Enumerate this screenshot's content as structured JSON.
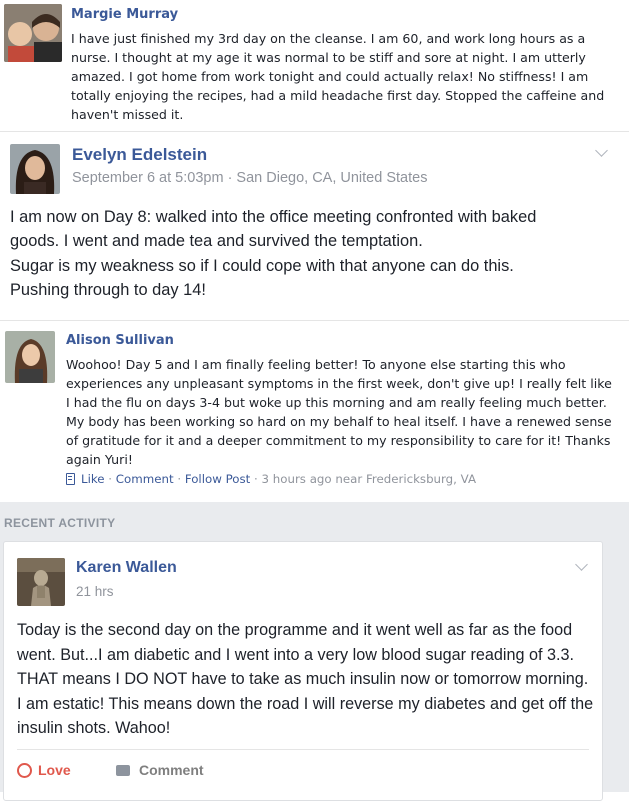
{
  "posts": [
    {
      "author": "Margie Murray",
      "text": "I have just finished my 3rd day on the cleanse. I am 60, and work long hours as a nurse. I thought at my age it was normal to be stiff and sore at night. I am utterly amazed. I got home from work tonight and could actually relax! No stiffness! I am totally enjoying the recipes, had a mild headache first day. Stopped the caffeine and haven't missed it."
    },
    {
      "author": "Evelyn Edelstein",
      "meta": "September 6 at 5:03pm · San Diego, CA, United States",
      "line1": "I am now on Day 8: walked into the office meeting confronted with baked",
      "line2": "goods. I went and made tea and survived the temptation.",
      "line3": "Sugar is my weakness so if I could cope with that anyone can do this.",
      "line4": "Pushing through to day 14!"
    },
    {
      "author": "Alison Sullivan",
      "text": "Woohoo! Day 5 and I am finally feeling better! To anyone else starting this who experiences any unpleasant symptoms in the first week, don't give up! I really felt like I had the flu on days 3-4 but woke up this morning and am really feeling much better. My body has been working so hard on my behalf to heal itself. I have a renewed sense of gratitude for it and a deeper commitment to my responsibility to care for it! Thanks again Yuri!",
      "actions": {
        "like": "Like",
        "sep1": " · ",
        "comment": "Comment",
        "sep2": " · ",
        "follow": "Follow Post",
        "time": " · 3 hours ago near Fredericksburg, VA"
      }
    }
  ],
  "recent_activity": {
    "header": "RECENT ACTIVITY",
    "post": {
      "author": "Karen Wallen",
      "meta": "21 hrs",
      "text": "Today is the second day on the programme and it went well as far as the food went. But...I am diabetic and I went into a very low blood sugar reading of 3.3. THAT means I DO NOT have to take as much insulin now or tomorrow morning. I am estatic! This means down the road I will reverse my diabetes and get off the insulin shots. Wahoo!",
      "love_label": "Love",
      "comment_label": "Comment"
    }
  },
  "colors": {
    "link": "#3b5998",
    "love": "#e0584c",
    "text": "#1d2129",
    "meta": "#90949c"
  }
}
